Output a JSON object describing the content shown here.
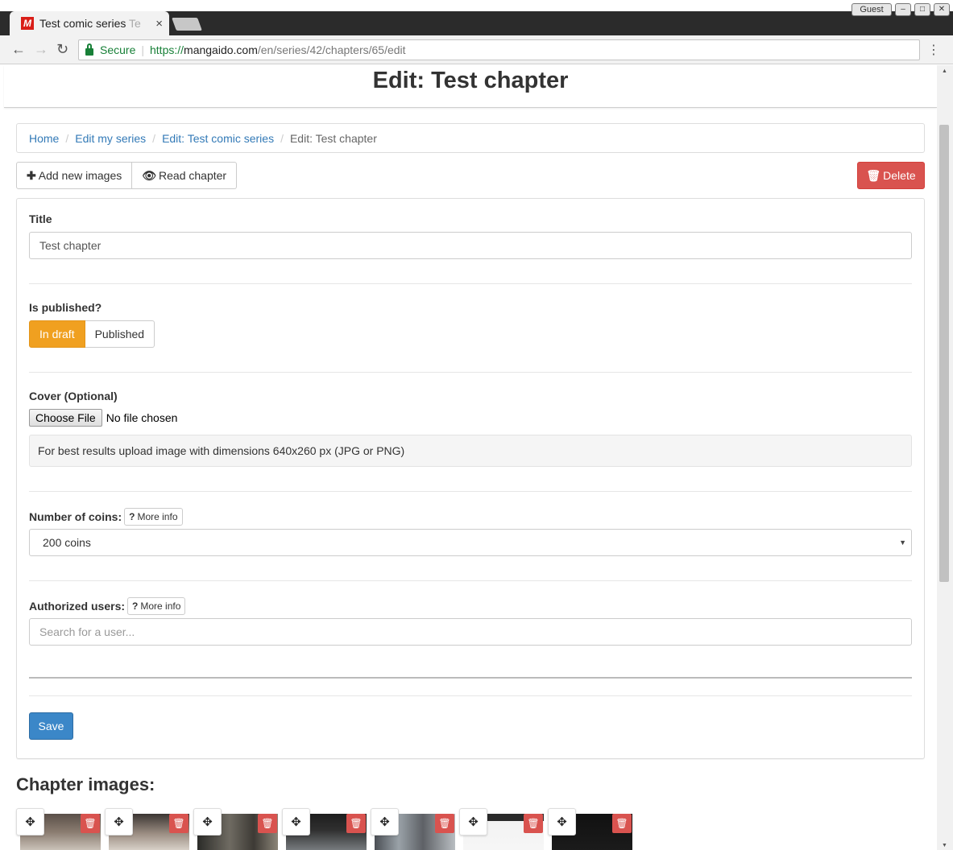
{
  "browser": {
    "tab_title": "Test comic series ",
    "tab_title_fade": "Te",
    "tab_close": "×",
    "favicon_letter": "M",
    "guest_label": "Guest",
    "secure_label": "Secure",
    "url_scheme": "https://",
    "url_host": "mangaido.com",
    "url_path": "/en/series/42/chapters/65/edit"
  },
  "header": {
    "title": "Edit: Test chapter"
  },
  "breadcrumb": {
    "items": [
      "Home",
      "Edit my series",
      "Edit: Test comic series"
    ],
    "current": "Edit: Test chapter"
  },
  "actions": {
    "add_images": "Add new images",
    "read_chapter": "Read chapter",
    "delete": "Delete"
  },
  "form": {
    "title_label": "Title",
    "title_value": "Test chapter",
    "published_label": "Is published?",
    "published_options": [
      "In draft",
      "Published"
    ],
    "published_selected": "In draft",
    "cover_label": "Cover (Optional)",
    "choose_file": "Choose File",
    "no_file": "No file chosen",
    "cover_help": "For best results upload image with dimensions 640x260 px (JPG or PNG)",
    "coins_label": "Number of coins:",
    "more_info": "More info",
    "coins_value": "200 coins",
    "auth_label": "Authorized users:",
    "auth_placeholder": "Search for a user...",
    "save": "Save"
  },
  "chapter_images": {
    "title": "Chapter images:",
    "count": 7
  },
  "colors": {
    "primary": "#337ab7",
    "danger": "#d9534f",
    "warning": "#f0a020",
    "secure_green": "#188038"
  }
}
